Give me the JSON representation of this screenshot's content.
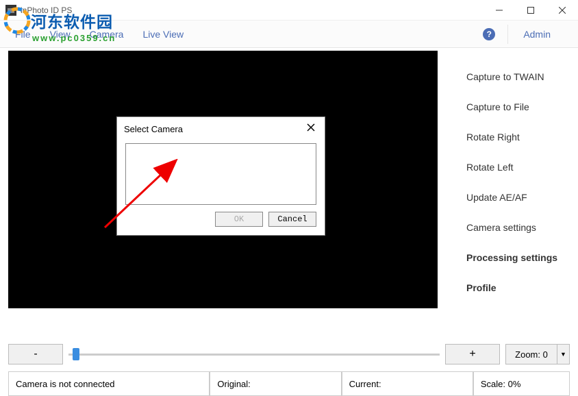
{
  "titlebar": {
    "title": "inPhoto ID PS"
  },
  "menu": {
    "items": [
      "File",
      "View",
      "Camera",
      "Live View"
    ],
    "admin": "Admin"
  },
  "sidebar": {
    "items": [
      {
        "label": "Capture to TWAIN",
        "bold": false
      },
      {
        "label": "Capture to File",
        "bold": false
      },
      {
        "label": "Rotate Right",
        "bold": false
      },
      {
        "label": "Rotate Left",
        "bold": false
      },
      {
        "label": "Update AE/AF",
        "bold": false
      },
      {
        "label": "Camera settings",
        "bold": false
      },
      {
        "label": "Processing settings",
        "bold": true
      },
      {
        "label": "Profile",
        "bold": true
      }
    ]
  },
  "zoom": {
    "minus": "-",
    "plus": "+",
    "label": "Zoom: 0",
    "value": 0
  },
  "status": {
    "camera": "Camera is not connected",
    "original": "Original:",
    "current": "Current:",
    "scale": "Scale: 0%"
  },
  "dialog": {
    "title": "Select Camera",
    "ok": "OK",
    "cancel": "Cancel"
  },
  "watermark": {
    "line1": "河东软件园",
    "line2": "www.pc0359.cn"
  }
}
